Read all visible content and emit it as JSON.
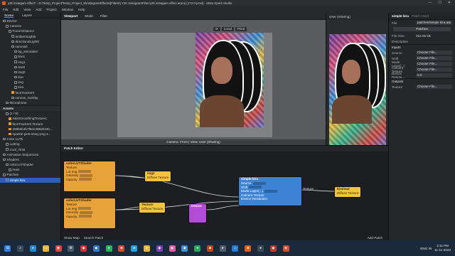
{
  "window": {
    "title": "y2k instagam effect* - D:/Temp_Project/Temp_Project_5/InstagramEffects/[Filter9] Y2K InstagramFilter/y2k instagam effect.arproj (173.0-prod) - Meta Spark Studio",
    "controls": [
      "—",
      "☐",
      "✕"
    ]
  },
  "menu": [
    "File",
    "Edit",
    "View",
    "Add",
    "Project",
    "Window",
    "Help"
  ],
  "scene_panel": {
    "tabs": [
      "Scene",
      "Layers"
    ],
    "tree": [
      {
        "label": "Device",
        "indent": 0
      },
      {
        "label": "Camera",
        "indent": 1
      },
      {
        "label": "Focal Distance",
        "indent": 2
      },
      {
        "label": "ambientLight0",
        "indent": 3
      },
      {
        "label": "directionalLight0",
        "indent": 3
      },
      {
        "label": "canvas0",
        "indent": 3
      },
      {
        "label": "bg_animation",
        "indent": 4
      },
      {
        "label": "line1",
        "indent": 4
      },
      {
        "label": "img1",
        "indent": 4
      },
      {
        "label": "line0",
        "indent": 4
      },
      {
        "label": "img0",
        "indent": 4
      },
      {
        "label": "line",
        "indent": 4
      },
      {
        "label": "img",
        "indent": 4
      },
      {
        "label": "kira",
        "indent": 4
      },
      {
        "label": "faceTracker0",
        "indent": 3,
        "orange": true
      },
      {
        "label": "canvas_overlay",
        "indent": 3
      },
      {
        "label": "Microphone",
        "indent": 1
      }
    ]
  },
  "assets_panel": {
    "title": "Assets",
    "items": [
      {
        "label": "(1 / 9)",
        "indent": 1
      },
      {
        "label": "SkinSmoothingTexture1",
        "indent": 2,
        "orange": true
      },
      {
        "label": "faceTracker0 Texture",
        "indent": 2,
        "orange": true
      },
      {
        "label": "298b8b4b7f8ee4982034b...",
        "indent": 2,
        "orange": true
      },
      {
        "label": "sparkle-pink-shiny-png-2...",
        "indent": 2,
        "orange": true
      },
      {
        "label": "Color LUTs",
        "indent": 0
      },
      {
        "label": "LutImg",
        "indent": 1
      },
      {
        "label": "Cool_Tints",
        "indent": 1
      },
      {
        "label": "Animation Sequences",
        "indent": 0
      },
      {
        "label": "Shaders",
        "indent": 0
      },
      {
        "label": "colorLUTShader",
        "indent": 1
      },
      {
        "label": "main",
        "indent": 2
      },
      {
        "label": "Patches",
        "indent": 0
      },
      {
        "label": "simple kira",
        "indent": 1,
        "selected": true
      }
    ]
  },
  "viewport": {
    "tabs": [
      "Viewport",
      "Mode",
      "Filter"
    ],
    "toolbar": [
      "⟳",
      "Local",
      "Pivot"
    ],
    "footer": "Camera: Front | View: User (Sharing)"
  },
  "user_preview": {
    "title": "User (Sharing)"
  },
  "inspector": {
    "title": "simple kira",
    "breadcrumb": "Patch Asset",
    "file_label": "File",
    "file_value": "patches/simple kira.arp",
    "patches_btn": "Patches",
    "size_label": "File Size",
    "size_value": "254.86 kB",
    "description_label": "Description",
    "inputs_label": "Inputs",
    "inputs": [
      {
        "k": "Source",
        "v": "Choose File..."
      },
      {
        "k": "Shift",
        "v": "Choose File..."
      },
      {
        "k": "Mode Layer(...)",
        "v": "Choose File..."
      },
      {
        "k": "Camera Texture",
        "v": "Choose File..."
      },
      {
        "k": "Device Resolu...",
        "v": "0.0"
      }
    ],
    "outputs_label": "Outputs",
    "outputs": [
      {
        "k": "Texture",
        "v": "Choose File..."
      }
    ]
  },
  "patch_editor": {
    "title": "Patch Editor",
    "footer_left": [
      "Show Map",
      "Search Patch"
    ],
    "footer_right": "Add Patch",
    "nodes": {
      "shader1": {
        "title": "colorLUTShader",
        "rows": [
          "Texture",
          "Lut Img",
          "Intensity",
          "Opacity"
        ]
      },
      "shader2": {
        "title": "colorLUTShader",
        "rows": [
          "Texture",
          "Lut Img",
          "Intensity",
          "Opacity"
        ]
      },
      "img1": {
        "title": "img1",
        "rows": [
          "Diffuse Texture"
        ]
      },
      "img2": {
        "title": "Texture",
        "rows": [
          "Diffuse Texture"
        ]
      },
      "device": {
        "title": "Device",
        "rows": [
          ""
        ]
      },
      "simple": {
        "title": "simple kira",
        "rows": [
          "Source",
          "Shift",
          "Mode Layer(...)",
          "Camera Texture",
          "Device Resolution"
        ]
      },
      "texout": {
        "title": "Texture",
        "rows": [
          ""
        ]
      },
      "kiraout": {
        "title": "kira/mat",
        "rows": [
          "Diffuse Texture"
        ]
      }
    }
  },
  "taskbar": {
    "lang": "ENG IN",
    "time": "2:11 PM",
    "date": "11-11-2023",
    "icons": [
      {
        "name": "windows",
        "glyph": "⊞",
        "color": "#2b7de9"
      },
      {
        "name": "search",
        "glyph": "⌕",
        "color": "#3a4a5a"
      },
      {
        "name": "edge",
        "glyph": "e",
        "color": "#1f8ad2"
      },
      {
        "name": "file-explorer",
        "glyph": "▭",
        "color": "#e8b73a"
      },
      {
        "name": "chrome",
        "glyph": "◉",
        "color": "#d6453a"
      },
      {
        "name": "settings",
        "glyph": "⚙",
        "color": "#4a5a6a"
      },
      {
        "name": "app-a",
        "glyph": "◆",
        "color": "#c8362f"
      },
      {
        "name": "app-b",
        "glyph": "◆",
        "color": "#2f7ac8"
      },
      {
        "name": "app-c",
        "glyph": "●",
        "color": "#1db954"
      },
      {
        "name": "app-d",
        "glyph": "■",
        "color": "#d14e2a"
      },
      {
        "name": "app-e",
        "glyph": "●",
        "color": "#22a3e0"
      },
      {
        "name": "app-f",
        "glyph": "●",
        "color": "#e8b73a"
      },
      {
        "name": "app-g",
        "glyph": "◆",
        "color": "#7f3fbf"
      },
      {
        "name": "app-h",
        "glyph": "◆",
        "color": "#e55ca0"
      },
      {
        "name": "app-i",
        "glyph": "◆",
        "color": "#3a8fd6"
      },
      {
        "name": "app-j",
        "glyph": "●",
        "color": "#26a65b"
      },
      {
        "name": "app-k",
        "glyph": "■",
        "color": "#b8471e"
      },
      {
        "name": "app-l",
        "glyph": "●",
        "color": "#555f6a"
      },
      {
        "name": "vscode",
        "glyph": "◇",
        "color": "#1e7ad6"
      },
      {
        "name": "app-m",
        "glyph": "■",
        "color": "#e05c1a"
      },
      {
        "name": "app-n",
        "glyph": "●",
        "color": "#3c4a58"
      },
      {
        "name": "app-o",
        "glyph": "◆",
        "color": "#c0392b"
      },
      {
        "name": "spark-studio",
        "glyph": "◈",
        "color": "#d14e2a"
      }
    ]
  }
}
